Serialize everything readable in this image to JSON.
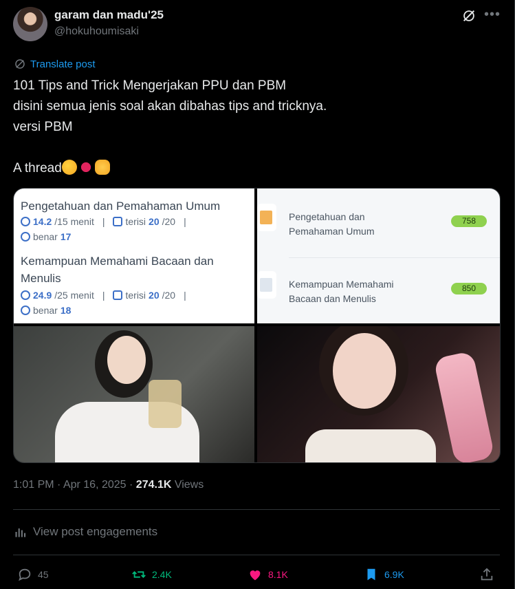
{
  "author": {
    "name": "garam dan madu'25",
    "handle": "@hokuhoumisaki"
  },
  "translate_label": "Translate post",
  "post_text": "101 Tips and Trick Mengerjakan PPU dan PBM\ndisini semua jenis soal akan dibahas tips and tricknya.\nversi PBM\n\nA thread",
  "emoji": [
    "smiling-face-with-hearts",
    "lips",
    "call-me-hand"
  ],
  "media": {
    "img1": {
      "section1_title": "Pengetahuan dan Pemahaman Umum",
      "section1_time": "14.2",
      "section1_time_total": "/15 menit",
      "section1_filled_label": "terisi",
      "section1_filled": "20",
      "section1_filled_total": "/20",
      "section1_correct_label": "benar",
      "section1_correct": "17",
      "section2_title_line1": "Kemampuan Memahami Bacaan dan",
      "section2_title_line2": "Menulis",
      "section2_time": "24.9",
      "section2_time_total": "/25 menit",
      "section2_filled_label": "terisi",
      "section2_filled": "20",
      "section2_filled_total": "/20",
      "section2_correct_label": "benar",
      "section2_correct": "18"
    },
    "img2": {
      "row1_label_line1": "Pengetahuan dan",
      "row1_label_line2": "Pemahaman Umum",
      "row1_score": "758",
      "row2_label_line1": "Kemampuan Memahami",
      "row2_label_line2": "Bacaan dan Menulis",
      "row2_score": "850"
    }
  },
  "meta": {
    "time": "1:01 PM",
    "date": "Apr 16, 2025",
    "views_count": "274.1K",
    "views_label": "Views"
  },
  "engagements_label": "View post engagements",
  "actions": {
    "replies": "45",
    "reposts": "2.4K",
    "likes": "8.1K",
    "bookmarks": "6.9K"
  },
  "colors": {
    "accent": "#1d9bf0",
    "repost": "#00ba7c",
    "like": "#f91880",
    "bookmark": "#1d9bf0",
    "muted": "#71767b"
  }
}
